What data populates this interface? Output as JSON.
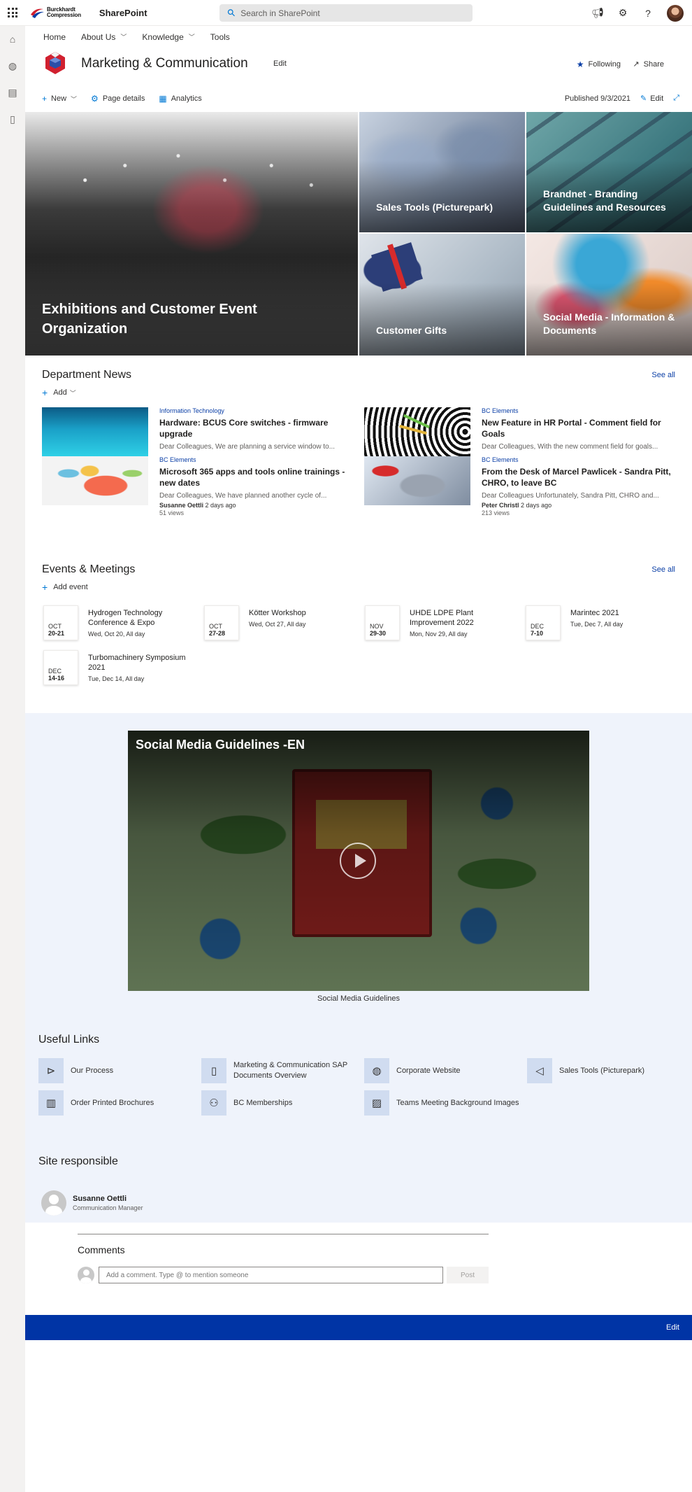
{
  "suite": {
    "brand_line1": "Burckhardt",
    "brand_line2": "Compression",
    "app_name": "SharePoint",
    "search_placeholder": "Search in SharePoint"
  },
  "topnav": [
    {
      "label": "Home"
    },
    {
      "label": "About Us"
    },
    {
      "label": "Knowledge"
    },
    {
      "label": "Tools"
    }
  ],
  "site": {
    "title": "Marketing & Communication",
    "edit_label": "Edit",
    "following_label": "Following",
    "share_label": "Share"
  },
  "cmdbar": {
    "new_label": "New",
    "page_details_label": "Page details",
    "analytics_label": "Analytics",
    "published": "Published 9/3/2021",
    "edit_label": "Edit"
  },
  "hero": {
    "exhibitions": "Exhibitions and Customer Event Organization",
    "sales_tools": "Sales Tools (Picturepark)",
    "brandnet": "Brandnet - Branding Guidelines and Resources",
    "gifts": "Customer Gifts",
    "social": "Social Media - Information & Documents"
  },
  "news": {
    "title": "Department News",
    "see_all": "See all",
    "add_label": "Add",
    "items": [
      {
        "category": "Information Technology",
        "title": "Hardware: BCUS Core switches - firmware upgrade",
        "excerpt": "Dear Colleagues, We are planning a service window to...",
        "author": "",
        "time": "",
        "views": ""
      },
      {
        "category": "BC Elements",
        "title": "Microsoft 365 apps and tools online trainings - new dates",
        "excerpt": "Dear Colleagues, We have planned another cycle of...",
        "author": "Susanne Oettli",
        "time": "2 days ago",
        "views": "51 views"
      },
      {
        "category": "BC Elements",
        "title": "New Feature in HR Portal - Comment field for Goals",
        "excerpt": "Dear Colleagues, With the new comment field for goals...",
        "author": "",
        "time": "",
        "views": ""
      },
      {
        "category": "BC Elements",
        "title": "From the Desk of Marcel Pawlicek - Sandra Pitt, CHRO, to leave BC",
        "excerpt": "Dear Colleagues Unfortunately, Sandra Pitt, CHRO and...",
        "author": "Peter Christl",
        "time": "2 days ago",
        "views": "213 views"
      }
    ]
  },
  "events": {
    "title": "Events & Meetings",
    "see_all": "See all",
    "add_label": "Add event",
    "items": [
      {
        "month": "OCT",
        "days": "20-21",
        "title": "Hydrogen Technology Conference & Expo",
        "when": "Wed, Oct 20, All day"
      },
      {
        "month": "OCT",
        "days": "27-28",
        "title": "Kötter Workshop",
        "when": "Wed, Oct 27, All day"
      },
      {
        "month": "NOV",
        "days": "29-30",
        "title": "UHDE LDPE Plant Improvement 2022",
        "when": "Mon, Nov 29, All day"
      },
      {
        "month": "DEC",
        "days": "7-10",
        "title": "Marintec 2021",
        "when": "Tue, Dec 7, All day"
      },
      {
        "month": "DEC",
        "days": "14-16",
        "title": "Turbomachinery Symposium 2021",
        "when": "Tue, Dec 14, All day"
      }
    ]
  },
  "video": {
    "title": "Social Media Guidelines -EN",
    "caption": "Social Media Guidelines"
  },
  "useful_links": {
    "title": "Useful Links",
    "items": [
      {
        "label": "Our Process",
        "icon": "process-icon"
      },
      {
        "label": "Marketing & Communication SAP Documents Overview",
        "icon": "document-icon"
      },
      {
        "label": "Corporate Website",
        "icon": "globe-icon"
      },
      {
        "label": "Sales Tools (Picturepark)",
        "icon": "megaphone-icon"
      },
      {
        "label": "Order Printed Brochures",
        "icon": "book-icon"
      },
      {
        "label": "BC Memberships",
        "icon": "people-icon"
      },
      {
        "label": "Teams Meeting Background Images",
        "icon": "image-icon"
      }
    ]
  },
  "responsible": {
    "title": "Site responsible",
    "name": "Susanne Oettli",
    "role": "Communication Manager"
  },
  "comments": {
    "title": "Comments",
    "placeholder": "Add a comment. Type @ to mention someone",
    "post_label": "Post"
  },
  "footer": {
    "edit_label": "Edit"
  },
  "colors": {
    "accent": "#0078d4",
    "brand_blue": "#0034a5",
    "link_blue": "#0b3fa6",
    "band_bg": "#eff3fb"
  }
}
